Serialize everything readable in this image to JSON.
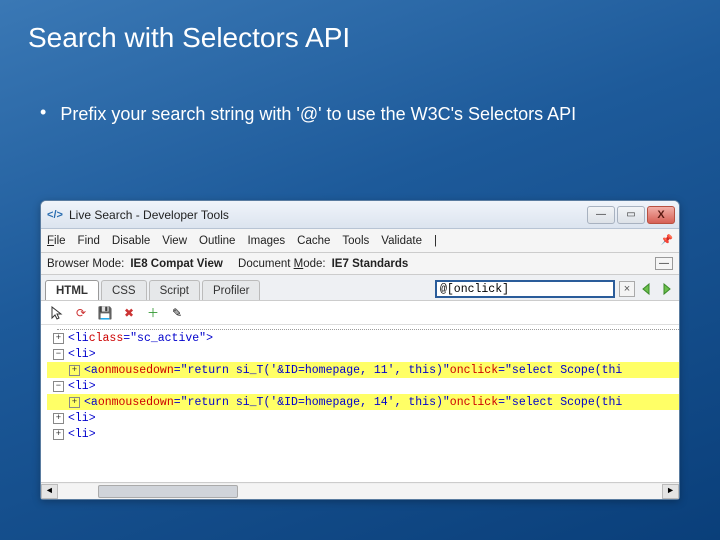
{
  "slide": {
    "title": "Search with Selectors API",
    "bullet": "Prefix your search string with '@' to use the W3C's Selectors API"
  },
  "window": {
    "title": "Live Search - Developer Tools",
    "menu": {
      "file": "File",
      "find": "Find",
      "disable": "Disable",
      "view": "View",
      "outline": "Outline",
      "images": "Images",
      "cache": "Cache",
      "tools": "Tools",
      "validate": "Validate"
    },
    "mode": {
      "browser_label": "Browser Mode:",
      "browser_value": "IE8 Compat View",
      "document_label": "Document Mode:",
      "document_value": "IE7 Standards"
    },
    "tabs": {
      "html": "HTML",
      "css": "CSS",
      "script": "Script",
      "profiler": "Profiler"
    },
    "search": {
      "value": "@[onclick]"
    },
    "dom": {
      "r0": "<li class=\"sc_active\">",
      "open_li": "<li>",
      "a_mousedown": "onmousedown",
      "a_onclick": "onclick",
      "r2_md": "\"return si_T('&ID=homepage, 11', this)\"",
      "r2_oc": "\"select Scope(thi",
      "r5_md": "\"return si_T('&ID=homepage, 14', this)\"",
      "r5_oc": "\"select Scope(thi",
      "a_open": "<a ",
      "li_tag": "li",
      "class_attr": "class",
      "class_val": "\"sc_active\""
    }
  }
}
